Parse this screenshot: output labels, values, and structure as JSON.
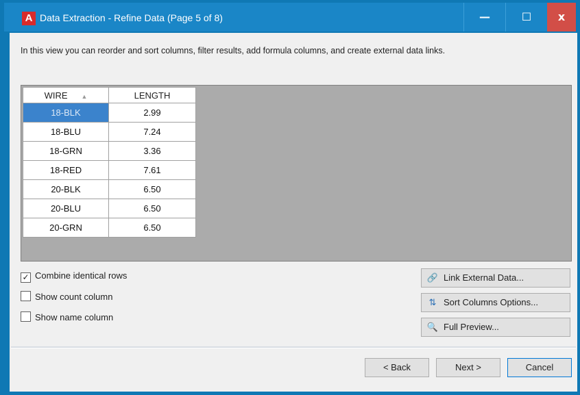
{
  "window": {
    "title": "Data Extraction - Refine Data (Page 5 of 8)",
    "app_icon_letter": "A",
    "minimize_label": "—",
    "maximize_label": "☐",
    "close_label": "x"
  },
  "description": "In this view you can reorder and sort columns, filter results, add formula columns, and create external data links.",
  "grid": {
    "columns": [
      "WIRE",
      "LENGTH"
    ],
    "rows": [
      [
        "18-BLK",
        "2.99"
      ],
      [
        "18-BLU",
        "7.24"
      ],
      [
        "18-GRN",
        "3.36"
      ],
      [
        "18-RED",
        "7.61"
      ],
      [
        "20-BLK",
        "6.50"
      ],
      [
        "20-BLU",
        "6.50"
      ],
      [
        "20-GRN",
        "6.50"
      ]
    ],
    "selected_row": 0,
    "sorted_column": "WIRE"
  },
  "options": {
    "combine_identical_rows": {
      "label": "Combine identical rows",
      "checked": true
    },
    "show_count_column": {
      "label": "Show count column",
      "checked": false
    },
    "show_name_column": {
      "label": "Show name column",
      "checked": false
    }
  },
  "side_buttons": {
    "link_external": "Link External Data...",
    "sort_options": "Sort Columns Options...",
    "full_preview": "Full Preview..."
  },
  "footer": {
    "back": "< Back",
    "next": "Next >",
    "cancel": "Cancel"
  },
  "colors": {
    "title_bar": "#1a86c7",
    "close_button": "#d24e47",
    "selected_cell": "#3b83cc",
    "grid_background": "#ababab"
  }
}
